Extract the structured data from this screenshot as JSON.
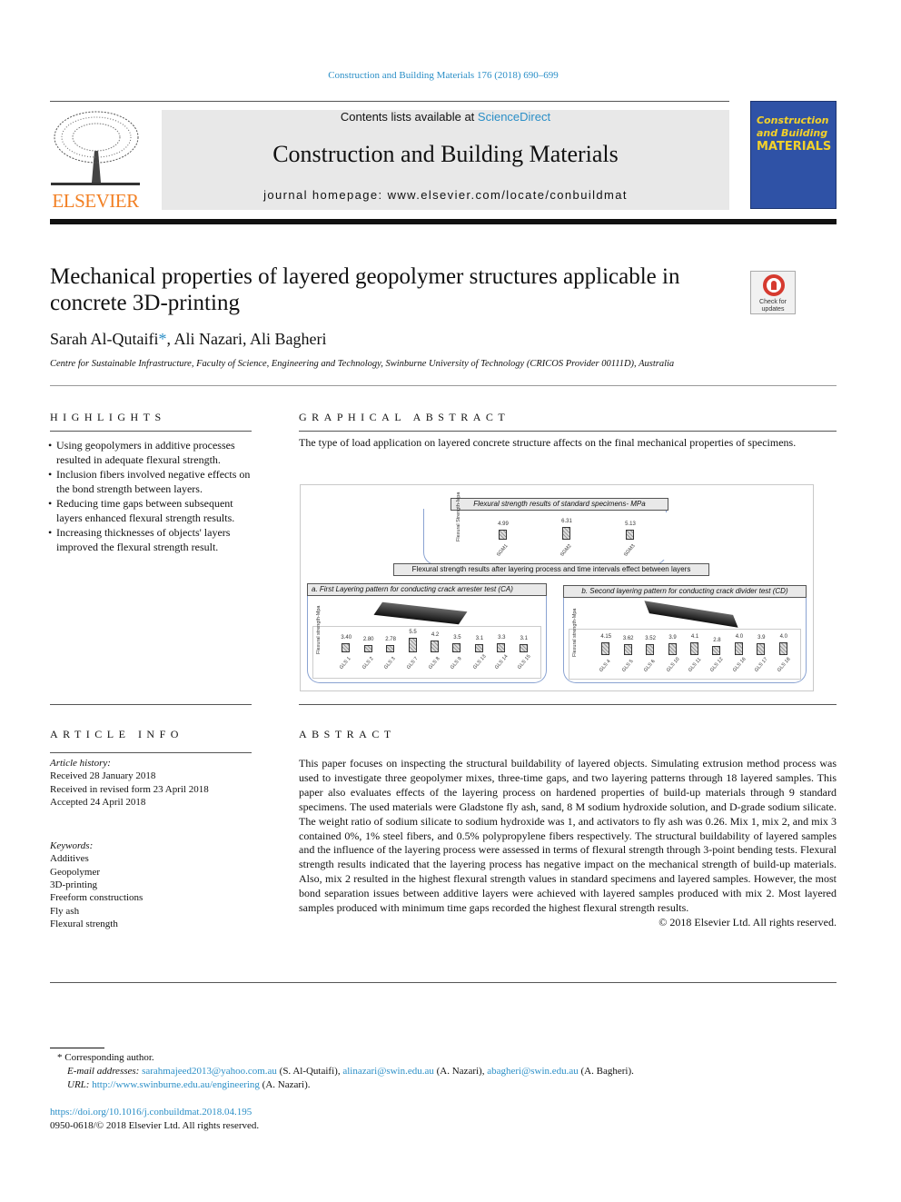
{
  "citation": "Construction and Building Materials 176 (2018) 690–699",
  "header": {
    "contents_prefix": "Contents lists available at ",
    "contents_link": "ScienceDirect",
    "journal_title": "Construction and Building Materials",
    "homepage": "journal homepage: www.elsevier.com/locate/conbuildmat",
    "publisher_logo": "ELSEVIER",
    "cover": {
      "line1": "Construction",
      "line2": "and Building",
      "line3": "MATERIALS"
    }
  },
  "article": {
    "title": "Mechanical properties of layered geopolymer structures applicable in concrete 3D-printing",
    "check_updates": "Check for updates",
    "authors": [
      {
        "name": "Sarah Al-Qutaifi",
        "mark": "*"
      },
      {
        "name": "Ali Nazari"
      },
      {
        "name": "Ali Bagheri"
      }
    ],
    "affiliation": "Centre for Sustainable Infrastructure, Faculty of Science, Engineering and Technology, Swinburne University of Technology (CRICOS Provider 00111D), Australia"
  },
  "highlights": {
    "heading": "HIGHLIGHTS",
    "items": [
      "Using geopolymers in additive processes resulted in adequate flexural strength.",
      "Inclusion fibers involved negative effects on the bond strength between layers.",
      "Reducing time gaps between subsequent layers enhanced flexural strength results.",
      "Increasing thicknesses of objects' layers improved the flexural strength result."
    ]
  },
  "graphical_abstract": {
    "heading": "GRAPHICAL ABSTRACT",
    "text": "The type of load application on layered concrete structure affects on the final mechanical properties of specimens.",
    "standard_title": "Flexural strength results of standard specimens- MPa",
    "standard_ylabel": "Flexural Strength-Mpa",
    "standard": {
      "categories": [
        "SGM1",
        "SGM2",
        "SGM3"
      ],
      "values": [
        4.99,
        6.31,
        5.13
      ]
    },
    "layering_title": "Flexural strength results after layering process and time intervals effect between layers",
    "panel_a": {
      "title": "a. First Layering pattern for conducting crack arrester test (CA)",
      "ylabel": "Flexural strength-Mpa",
      "ticks": [
        "6",
        "4",
        "2",
        "0"
      ],
      "categories": [
        "GLS 1",
        "GLS 2",
        "GLS 3",
        "GLS 7",
        "GLS 8",
        "GLS 9",
        "GLS 13",
        "GLS 14",
        "GLS 15"
      ],
      "values": [
        3.4,
        2.8,
        2.78,
        5.5,
        4.2,
        3.5,
        3.1,
        3.3,
        3.1
      ],
      "value_labels": [
        "3.40",
        "2.80",
        "2.78",
        "5.5",
        "4.2",
        "3.5",
        "3.1",
        "3.3",
        "3.1"
      ]
    },
    "panel_b": {
      "title": "b. Second layering pattern for conducting crack divider test (CD)",
      "ylabel": "Flexural strength-Mpa",
      "ticks": [
        "5",
        "0"
      ],
      "categories": [
        "GLS 4",
        "GLS 5",
        "GLS 6",
        "GLS 10",
        "GLS 11",
        "GLS 12",
        "GLS 16",
        "GLS 17",
        "GLS 18"
      ],
      "values": [
        4.15,
        3.62,
        3.52,
        3.9,
        4.1,
        2.8,
        4.0,
        3.9,
        4.0
      ],
      "value_labels": [
        "4.15",
        "3.62",
        "3.52",
        "3.9",
        "4.1",
        "2.8",
        "4.0",
        "3.9",
        "4.0"
      ]
    }
  },
  "article_info": {
    "heading": "ARTICLE INFO",
    "history_label": "Article history:",
    "history": [
      "Received 28 January 2018",
      "Received in revised form 23 April 2018",
      "Accepted 24 April 2018"
    ],
    "keywords_label": "Keywords:",
    "keywords": [
      "Additives",
      "Geopolymer",
      "3D-printing",
      "Freeform constructions",
      "Fly ash",
      "Flexural strength"
    ]
  },
  "abstract": {
    "heading": "ABSTRACT",
    "text": "This paper focuses on inspecting the structural buildability of layered objects. Simulating extrusion method process was used to investigate three geopolymer mixes, three-time gaps, and two layering patterns through 18 layered samples. This paper also evaluates effects of the layering process on hardened properties of build-up materials through 9 standard specimens. The used materials were Gladstone fly ash, sand, 8 M sodium hydroxide solution, and D-grade sodium silicate. The weight ratio of sodium silicate to sodium hydroxide was 1, and activators to fly ash was 0.26. Mix 1, mix 2, and mix 3 contained 0%, 1% steel fibers, and 0.5% polypropylene fibers respectively. The structural buildability of layered samples and the influence of the layering process were assessed in terms of flexural strength through 3-point bending tests. Flexural strength results indicated that the layering process has negative impact on the mechanical strength of build-up materials. Also, mix 2 resulted in the highest flexural strength values in standard specimens and layered samples. However, the most bond separation issues between additive layers were achieved with layered samples produced with mix 2. Most layered samples produced with minimum time gaps recorded the highest flexural strength results.",
    "copyright": "© 2018 Elsevier Ltd. All rights reserved."
  },
  "footnotes": {
    "corresponding": "* Corresponding author.",
    "email_label": "E-mail addresses:",
    "emails": [
      {
        "addr": "sarahmajeed2013@yahoo.com.au",
        "who": "(S. Al-Qutaifi),"
      },
      {
        "addr": "alinazari@swin.edu.au",
        "who": "(A. Nazari),"
      },
      {
        "addr": "abagheri@swin.edu.au",
        "who": "(A. Bagheri)."
      }
    ],
    "url_label": "URL:",
    "url": "http://www.swinburne.edu.au/engineering",
    "url_who": "(A. Nazari)."
  },
  "doi": "https://doi.org/10.1016/j.conbuildmat.2018.04.195",
  "issn": "0950-0618/© 2018 Elsevier Ltd. All rights reserved."
}
